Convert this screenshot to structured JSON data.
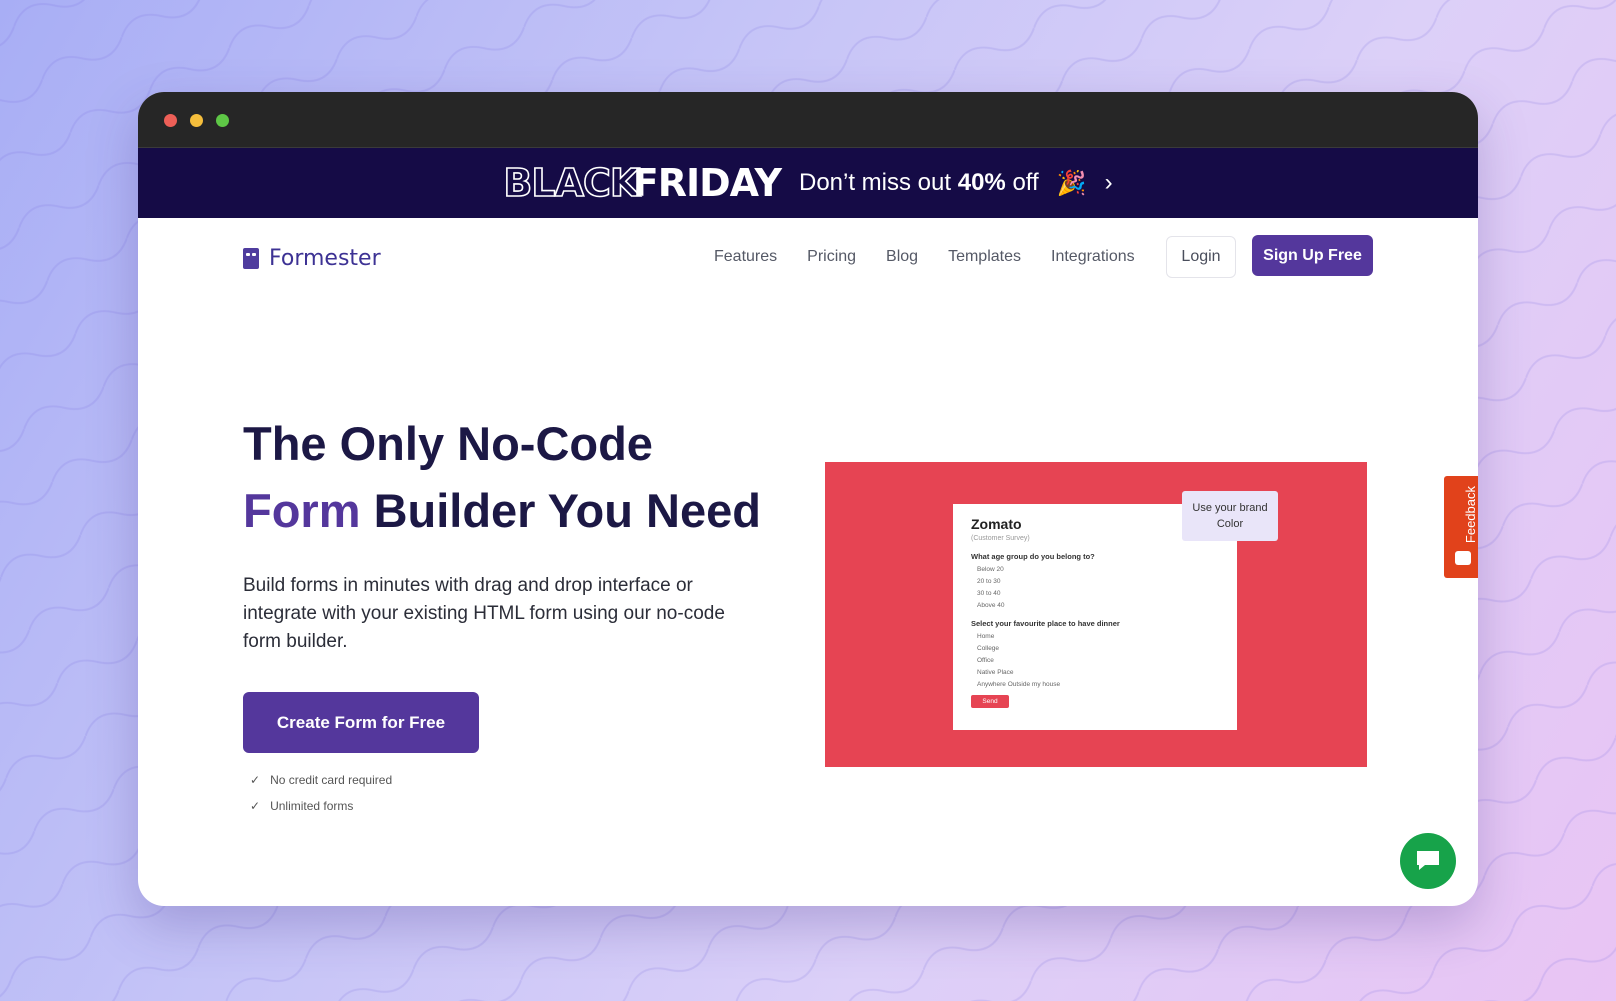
{
  "promo": {
    "black": "BLACK",
    "friday": "FRIDAY",
    "text_before": "Don’t miss out",
    "discount": "40%",
    "text_after": "off",
    "emoji": "🎉",
    "arrow": "›"
  },
  "nav": {
    "logo_text": "Formester",
    "links": [
      "Features",
      "Pricing",
      "Blog",
      "Templates",
      "Integrations"
    ],
    "login_label": "Login",
    "signup_label": "Sign Up Free"
  },
  "hero": {
    "title_line1": "The Only No-Code",
    "title_accent": "Form",
    "title_line2_rest": "Builder You Need",
    "subtitle": "Build forms in minutes with drag and drop interface or integrate with your existing HTML form using our no-code form builder.",
    "cta_label": "Create Form for Free",
    "checks": [
      "No credit card required",
      "Unlimited forms"
    ],
    "check_icon": "✓"
  },
  "preview": {
    "form_title": "Zomato",
    "form_subtitle": "(Customer Survey)",
    "question1": "What age group do you belong to?",
    "q1_options": [
      "Below 20",
      "20 to 30",
      "30 to 40",
      "Above 40"
    ],
    "question2": "Select your favourite place to have dinner",
    "q2_options": [
      "Home",
      "College",
      "Office",
      "Native Place",
      "Anywhere Outside my house"
    ],
    "send_label": "Send",
    "tip_line1": "Use your brand",
    "tip_line2": "Color"
  },
  "widgets": {
    "feedback_label": "Feedback"
  },
  "colors": {
    "brand": "#54379c",
    "promo_bg": "#150b46",
    "preview_bg": "#e64453",
    "feedback": "#e1421b",
    "chat": "#17a34a"
  }
}
